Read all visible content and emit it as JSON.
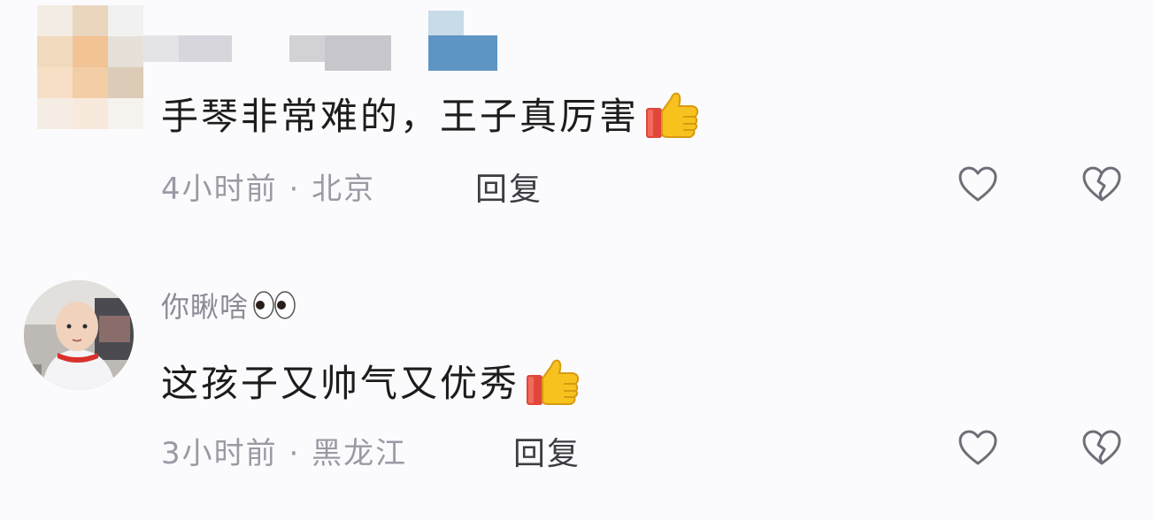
{
  "comments": [
    {
      "username": "",
      "text": "手琴非常难的，王子真厉害",
      "emoji": "thumbs-up-icon",
      "time": "4小时前",
      "location": "北京",
      "reply_label": "回复"
    },
    {
      "username": "你瞅啥",
      "username_emoji": "eyes-icon",
      "text": "这孩子又帅气又优秀",
      "emoji": "thumbs-up-icon",
      "time": "3小时前",
      "location": "黑龙江",
      "reply_label": "回复"
    }
  ],
  "separator": "·",
  "colors": {
    "background": "#fbfbfd",
    "text": "#1c1c1c",
    "meta": "#9a9aa5",
    "username": "#8c8c98",
    "icon_outline": "#6e6e78"
  }
}
